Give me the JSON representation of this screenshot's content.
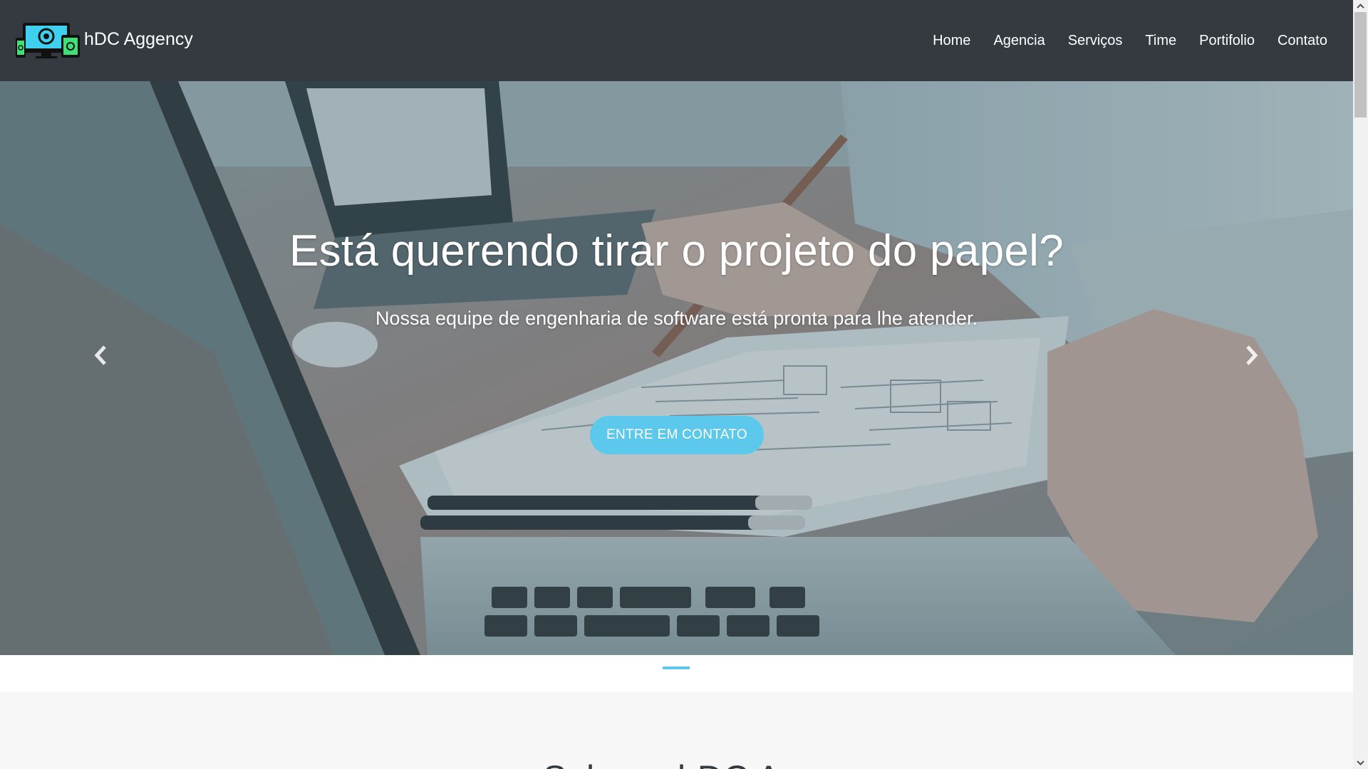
{
  "navbar": {
    "brand": "hDC Aggency",
    "links": [
      "Home",
      "Agencia",
      "Serviços",
      "Time",
      "Portifolio",
      "Contato"
    ]
  },
  "hero": {
    "title": "Está querendo tirar o projeto do papel?",
    "subtitle": "Nossa equipe de engenharia de software está pronta para lhe atender.",
    "cta_label": "ENTRE EM CONTATO"
  },
  "section": {
    "title_partial": "Sobre a hDC A..."
  },
  "icons": {
    "logo": "devices-logo-icon",
    "prev": "chevron-left-icon",
    "next": "chevron-right-icon",
    "scroll_up": "arrow-up-icon",
    "scroll_down": "arrow-down-icon"
  },
  "colors": {
    "navbar": "#343a40",
    "accent": "#5bc8ec",
    "text_on_dark": "#ffffff"
  }
}
